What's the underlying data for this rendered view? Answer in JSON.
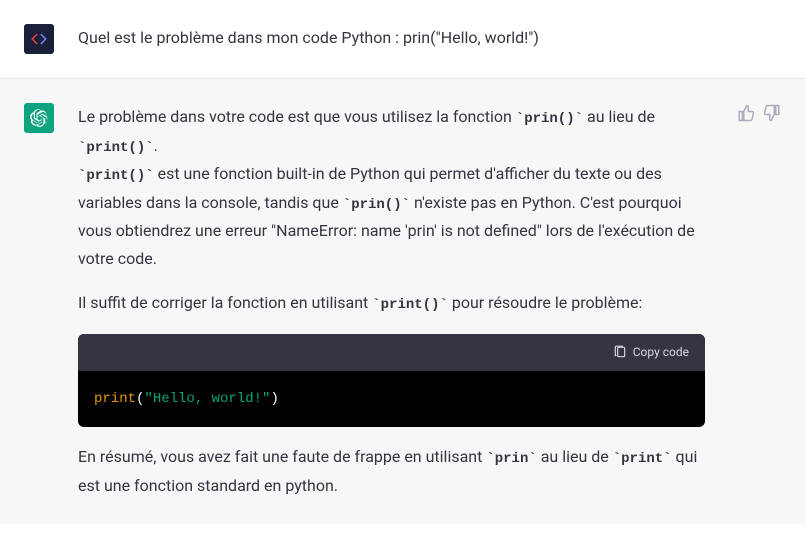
{
  "user": {
    "message": "Quel est le problème dans mon code Python : prin(\"Hello, world!\")"
  },
  "assistant": {
    "p1_pre": "Le problème dans votre code est que vous utilisez la fonction ",
    "p1_code1": "prin()",
    "p1_mid": " au lieu de ",
    "p1_code2": "print()",
    "p1_end": ".",
    "p2_code1": "print()",
    "p2_a": " est une fonction built-in de Python qui permet d'afficher du texte ou des variables dans la console, tandis que ",
    "p2_code2": "prin()",
    "p2_b": " n'existe pas en Python. C'est pourquoi vous obtiendrez une erreur \"NameError: name 'prin' is not defined\" lors de l'exécution de votre code.",
    "p3_a": "Il suffit de corriger la fonction en utilisant ",
    "p3_code": "print()",
    "p3_b": " pour résoudre le problème:",
    "code": {
      "copy_label": "Copy code",
      "fn": "print",
      "open": "(",
      "str": "\"Hello, world!\"",
      "close": ")"
    },
    "p4_a": "En résumé, vous avez fait une faute de frappe en utilisant ",
    "p4_code1": "prin",
    "p4_b": " au lieu de ",
    "p4_code2": "print",
    "p4_c": " qui est une fonction standard en python."
  }
}
